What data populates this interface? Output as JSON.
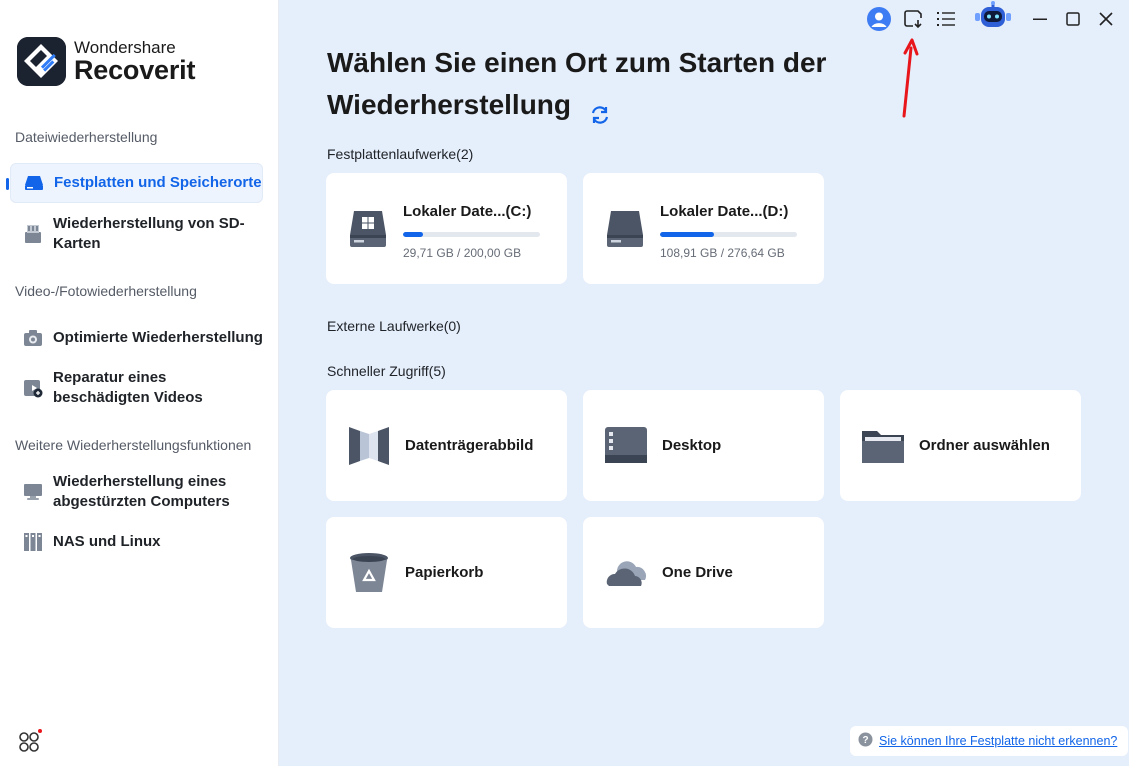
{
  "brand": {
    "company": "Wondershare",
    "product": "Recoverit"
  },
  "sidebar": {
    "sections": [
      {
        "title": "Dateiwiederherstellung"
      },
      {
        "title": "Video-/Fotowiederherstellung"
      },
      {
        "title": "Weitere Wiederherstellungsfunktionen"
      }
    ],
    "items": [
      {
        "label": "Festplatten und Speicherorte",
        "icon": "hard-drive-icon",
        "active": true
      },
      {
        "label": "Wiederherstellung von SD-Karten",
        "icon": "sd-card-icon"
      },
      {
        "label": "Optimierte Wiederherstellung",
        "icon": "camera-icon"
      },
      {
        "label": "Reparatur eines beschädigten Videos",
        "icon": "video-repair-icon"
      },
      {
        "label": "Wiederherstellung eines abgestürzten Computers",
        "icon": "monitor-icon"
      },
      {
        "label": "NAS und Linux",
        "icon": "nas-icon"
      }
    ],
    "apps_icon": "apps-grid-icon"
  },
  "main": {
    "title": "Wählen Sie einen Ort zum Starten der Wiederherstellung",
    "groups": {
      "hard_drives": "Festplattenlaufwerke(2)",
      "external": "Externe Laufwerke(0)",
      "quick_access": "Schneller Zugriff(5)"
    },
    "drives": [
      {
        "name": "Lokaler Date...(C:)",
        "size": "29,71 GB / 200,00 GB",
        "usage": 0.1486,
        "icon": "windows-drive-icon"
      },
      {
        "name": "Lokaler Date...(D:)",
        "size": "108,91 GB / 276,64 GB",
        "usage": 0.3937,
        "icon": "drive-icon"
      }
    ],
    "quick_access": [
      {
        "label": "Datenträgerabbild",
        "icon": "disk-image-icon"
      },
      {
        "label": "Desktop",
        "icon": "desktop-icon"
      },
      {
        "label": "Ordner auswählen",
        "icon": "folder-icon"
      },
      {
        "label": "Papierkorb",
        "icon": "recycle-bin-icon"
      },
      {
        "label": "One Drive",
        "icon": "onedrive-icon"
      }
    ]
  },
  "help": {
    "link": "Sie können Ihre Festplatte nicht erkennen?"
  },
  "colors": {
    "accent": "#1265e8",
    "main_bg": "#e5eefb",
    "annotation": "#e8151b"
  }
}
